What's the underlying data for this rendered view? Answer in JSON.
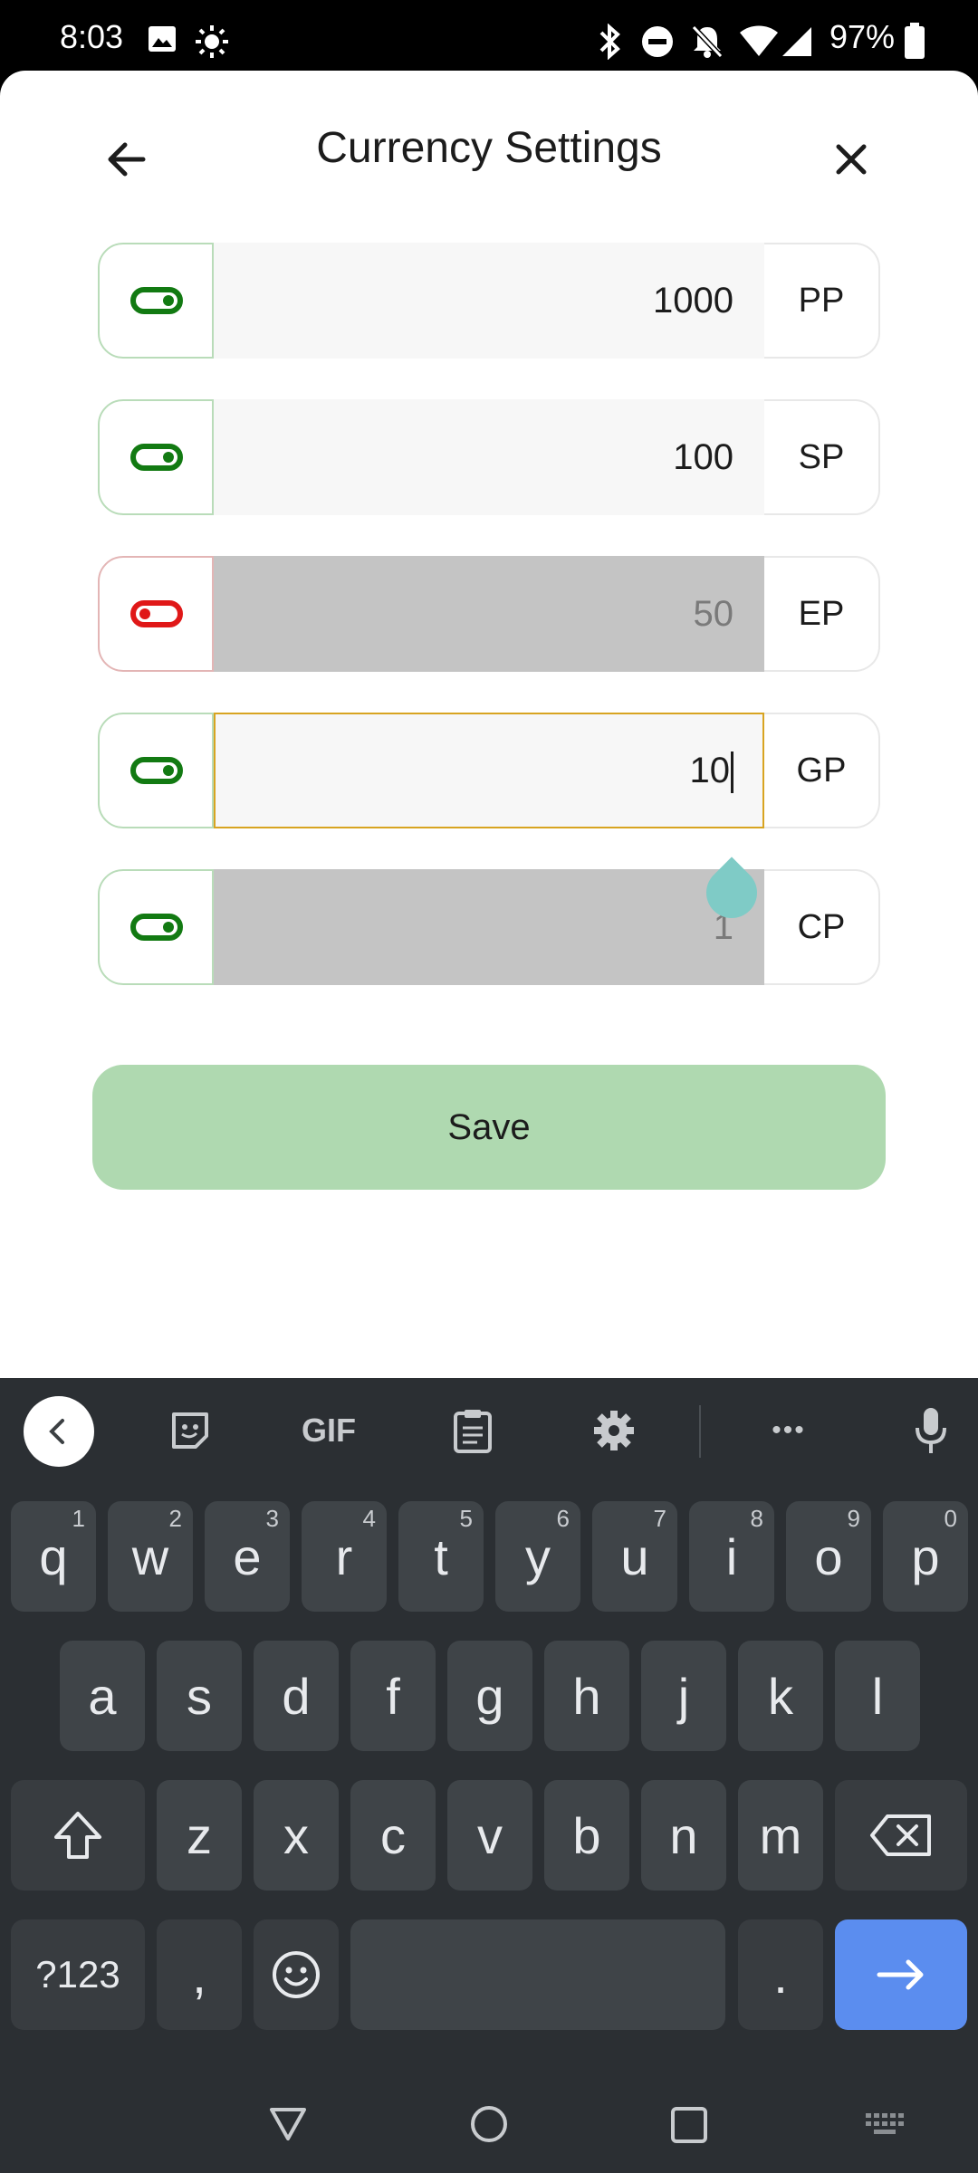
{
  "status_bar": {
    "time": "8:03",
    "battery": "97%",
    "left_icons": [
      "image-icon",
      "brightness-icon"
    ],
    "right_icons": [
      "bluetooth-icon",
      "dnd-icon",
      "bell-off-icon",
      "wifi-icon",
      "cellular-icon",
      "battery-icon"
    ]
  },
  "header": {
    "title": "Currency Settings",
    "back_icon": "arrow-left-icon",
    "close_icon": "close-icon"
  },
  "currencies": [
    {
      "enabled": true,
      "value": "1000",
      "unit": "PP",
      "editable": true
    },
    {
      "enabled": true,
      "value": "100",
      "unit": "SP",
      "editable": true
    },
    {
      "enabled": false,
      "value": "50",
      "unit": "EP",
      "editable": false
    },
    {
      "enabled": true,
      "value": "10",
      "unit": "GP",
      "editable": true,
      "focused": true
    },
    {
      "enabled": true,
      "value": "1",
      "unit": "CP",
      "editable": false
    }
  ],
  "save_label": "Save",
  "colors": {
    "toggle_on": "#127a12",
    "toggle_off": "#e01818",
    "save_button": "#afd9b0",
    "focus_border": "#d8a421",
    "enter_key": "#5b8def"
  },
  "keyboard": {
    "toolbar": {
      "gif_label": "GIF",
      "more_label": "•••",
      "icons": [
        "chevron-left-icon",
        "sticker-icon",
        "clipboard-icon",
        "settings-icon",
        "microphone-icon"
      ]
    },
    "row1": [
      {
        "k": "q",
        "h": "1"
      },
      {
        "k": "w",
        "h": "2"
      },
      {
        "k": "e",
        "h": "3"
      },
      {
        "k": "r",
        "h": "4"
      },
      {
        "k": "t",
        "h": "5"
      },
      {
        "k": "y",
        "h": "6"
      },
      {
        "k": "u",
        "h": "7"
      },
      {
        "k": "i",
        "h": "8"
      },
      {
        "k": "o",
        "h": "9"
      },
      {
        "k": "p",
        "h": "0"
      }
    ],
    "row2": [
      "a",
      "s",
      "d",
      "f",
      "g",
      "h",
      "j",
      "k",
      "l"
    ],
    "row3": [
      "z",
      "x",
      "c",
      "v",
      "b",
      "n",
      "m"
    ],
    "symbols_label": "?123",
    "comma_label": ",",
    "period_label": "."
  }
}
